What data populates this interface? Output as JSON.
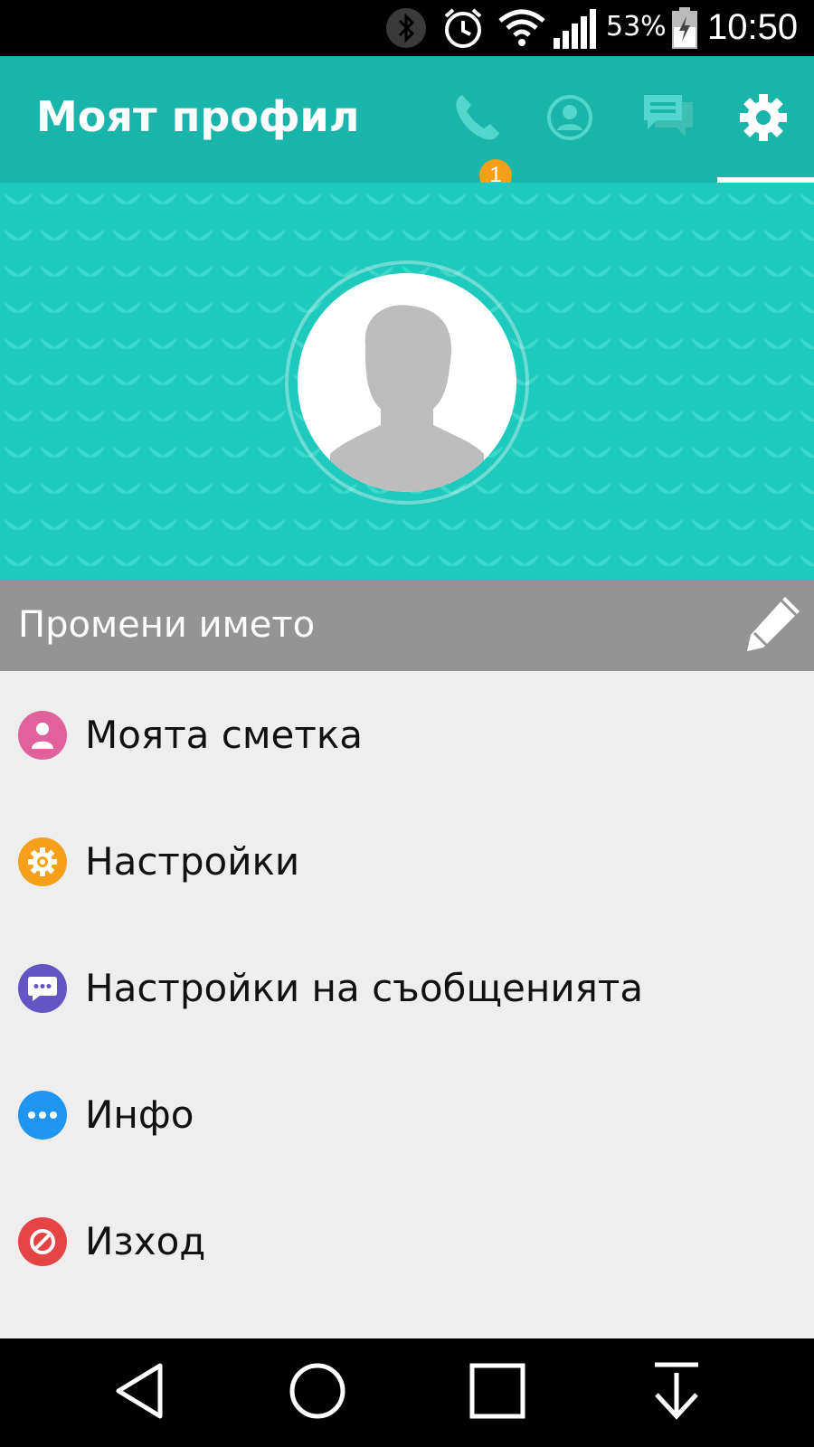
{
  "status_bar": {
    "battery_percent": "53%",
    "time": "10:50",
    "icons": [
      "bluetooth-icon",
      "alarm-icon",
      "wifi-icon",
      "signal-icon",
      "battery-charging-icon"
    ]
  },
  "app_bar": {
    "title": "Моят профил",
    "tabs": [
      {
        "name": "calls",
        "icon": "phone-icon",
        "badge": "1"
      },
      {
        "name": "contacts",
        "icon": "contact-icon"
      },
      {
        "name": "messages",
        "icon": "chat-icon"
      },
      {
        "name": "settings",
        "icon": "gear-icon",
        "selected": true
      }
    ],
    "colors": {
      "background": "#19b5ab",
      "inactive_icon": "#53d6cc",
      "active_icon": "#ffffff",
      "badge": "#f6a01a"
    }
  },
  "profile": {
    "header_color": "#1ec9bd",
    "avatar_icon": "person-silhouette-icon"
  },
  "name_bar": {
    "label": "Промени името",
    "icon": "pencil-icon"
  },
  "menu": {
    "items": [
      {
        "label": "Моята сметка",
        "icon": "person-icon",
        "color": "#e0619b"
      },
      {
        "label": "Настройки",
        "icon": "gear-icon",
        "color": "#f6a01a"
      },
      {
        "label": "Настройки на съобщенията",
        "icon": "chat-bubble-icon",
        "color": "#6355c4"
      },
      {
        "label": "Инфо",
        "icon": "more-icon",
        "color": "#1e96f0"
      },
      {
        "label": "Изход",
        "icon": "block-icon",
        "color": "#e54444"
      }
    ]
  },
  "nav_bar": {
    "buttons": [
      "back-icon",
      "home-icon",
      "recents-icon",
      "notifications-pull-icon"
    ]
  }
}
